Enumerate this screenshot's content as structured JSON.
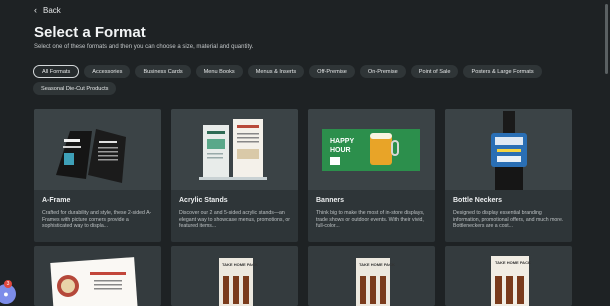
{
  "nav": {
    "back_label": "Back"
  },
  "page": {
    "title": "Select a Format",
    "subtitle": "Select one of these formats and then you can choose a size, material and quantity."
  },
  "filters": [
    {
      "label": "All Formats",
      "active": true
    },
    {
      "label": "Accessories",
      "active": false
    },
    {
      "label": "Business Cards",
      "active": false
    },
    {
      "label": "Menu Books",
      "active": false
    },
    {
      "label": "Menus & Inserts",
      "active": false
    },
    {
      "label": "Off-Premise",
      "active": false
    },
    {
      "label": "On-Premise",
      "active": false
    },
    {
      "label": "Point of Sale",
      "active": false
    },
    {
      "label": "Posters & Large Formats",
      "active": false
    },
    {
      "label": "Seasonal Die-Cut Products",
      "active": false
    }
  ],
  "cards": [
    {
      "name": "A-Frame",
      "description": "Crafted for durability and style, these 2-sided A-Frames with picture corners provide a sophisticated way to displa..."
    },
    {
      "name": "Acrylic Stands",
      "description": "Discover our 2 and 5-sided acrylic stands—an elegant way to showcase menus, promotions, or featured items..."
    },
    {
      "name": "Banners",
      "description": "Think big to make the most of in-store displays, trade shows or outdoor events. With their vivid, full-color..."
    },
    {
      "name": "Bottle Neckers",
      "description": "Designed to display essential branding information, promotional offers, and much more. Bottleneckers are a cost..."
    }
  ],
  "card_art": {
    "banner_line1": "HAPPY",
    "banner_line2": "HOUR",
    "pack_label": "TAKE HOME PACK"
  },
  "colors": {
    "background": "#1e2224",
    "card": "#2e3538",
    "chip": "#2f3537",
    "accent": "#7d8de9"
  },
  "help": {
    "badge_count": "3",
    "icon": "chat-icon"
  }
}
